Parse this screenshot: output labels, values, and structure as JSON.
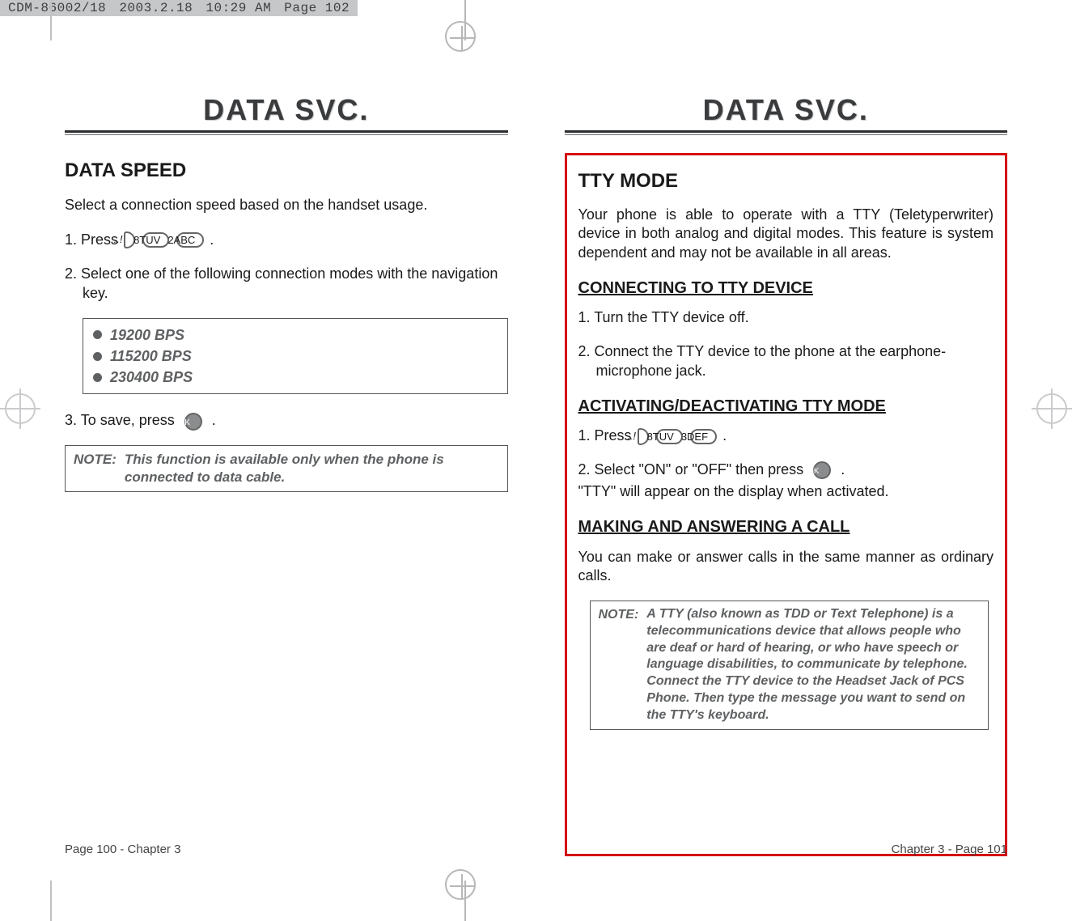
{
  "header": {
    "file": "CDM-86002/18",
    "date": "2003.2.18",
    "time": "10:29 AM",
    "page_ref": "Page 102"
  },
  "icons": {
    "menu_label": "...!",
    "btn_8tuv": "8TUV",
    "btn_2abc": "2ABC",
    "btn_3def": "3DEF",
    "ok_label": "OK"
  },
  "left_page": {
    "title": "DATA SVC.",
    "section_heading": "DATA SPEED",
    "intro": "Select a connection speed based on the handset usage.",
    "step1_prefix": "1. Press",
    "step1_suffix": ".",
    "step2": "2. Select one of the following connection modes with the navigation key.",
    "options": [
      "19200 BPS",
      "115200 BPS",
      "230400 BPS"
    ],
    "step3_prefix": "3. To save, press",
    "step3_suffix": ".",
    "note_label": "NOTE:",
    "note_text": "This function is available only when the phone is connected to data cable.",
    "footer": "Page 100 - Chapter 3"
  },
  "right_page": {
    "title": "DATA SVC.",
    "section_heading": "TTY MODE",
    "intro": "Your phone is able to operate with a TTY (Teletyperwriter) device in both analog and digital modes. This feature is system dependent and may not be available in all areas.",
    "h_connecting": "CONNECTING TO TTY DEVICE",
    "conn_step1": "1. Turn the TTY device off.",
    "conn_step2": "2. Connect the TTY device to the phone at the earphone-microphone jack.",
    "h_activating": "ACTIVATING/DEACTIVATING TTY MODE",
    "act_step1_prefix": "1. Press",
    "act_step1_suffix": ".",
    "act_step2_prefix": "2. Select \"ON\" or \"OFF\" then press",
    "act_step2_suffix": ".",
    "act_step2_line2": "\"TTY\" will appear on the display when activated.",
    "h_making": "MAKING AND ANSWERING A CALL",
    "making_text": "You can make or answer calls in the same manner as ordinary calls.",
    "note_label": "NOTE:",
    "note_text": "A TTY (also known as TDD or Text Telephone) is a telecommunications device that allows people who are deaf or hard of hearing, or who have speech or language disabilities, to communicate by telephone. Connect the TTY device to the Headset Jack of PCS Phone. Then type the message you want to send on the TTY's keyboard.",
    "footer": "Chapter 3 - Page  101"
  }
}
